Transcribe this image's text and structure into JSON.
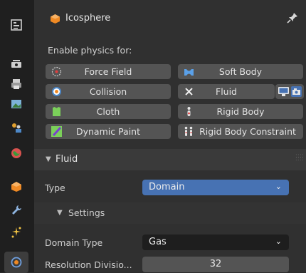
{
  "header": {
    "title": "Icosphere",
    "object_icon": "orange-mesh-icon",
    "pin_icon": "pin-icon"
  },
  "tabs": [
    {
      "name": "tool-tab",
      "icon": "tool-settings-icon"
    },
    {
      "name": "render-tab",
      "icon": "render-icon"
    },
    {
      "name": "output-tab",
      "icon": "printer-icon"
    },
    {
      "name": "view-layer-tab",
      "icon": "image-icon"
    },
    {
      "name": "scene-tab",
      "icon": "scene-icon"
    },
    {
      "name": "world-tab",
      "icon": "world-icon"
    },
    {
      "name": "object-tab",
      "icon": "object-icon"
    },
    {
      "name": "modifiers-tab",
      "icon": "wrench-icon"
    },
    {
      "name": "particles-tab",
      "icon": "particles-icon"
    },
    {
      "name": "physics-tab",
      "icon": "physics-icon",
      "active": true
    }
  ],
  "physics": {
    "enable_label": "Enable physics for:",
    "buttons": [
      {
        "label": "Force Field",
        "icon": "force-field-icon"
      },
      {
        "label": "Soft Body",
        "icon": "soft-body-icon"
      },
      {
        "label": "Collision",
        "icon": "collision-icon"
      },
      {
        "label": "Fluid",
        "icon": "x-icon"
      },
      {
        "label": "Cloth",
        "icon": "cloth-icon"
      },
      {
        "label": "Rigid Body",
        "icon": "rigid-body-icon"
      },
      {
        "label": "Dynamic Paint",
        "icon": "dynamic-paint-icon"
      },
      {
        "label": "Rigid Body Constraint",
        "icon": "rigid-body-constraint-icon"
      }
    ]
  },
  "fluid_panel": {
    "title": "Fluid",
    "type_label": "Type",
    "type_value": "Domain",
    "settings_title": "Settings",
    "domain_type_label": "Domain Type",
    "domain_type_value": "Gas",
    "resolution_label": "Resolution Divisio...",
    "resolution_value": "32"
  },
  "colors": {
    "accent": "#4772b3",
    "bg": "#303030",
    "button": "#545454"
  }
}
